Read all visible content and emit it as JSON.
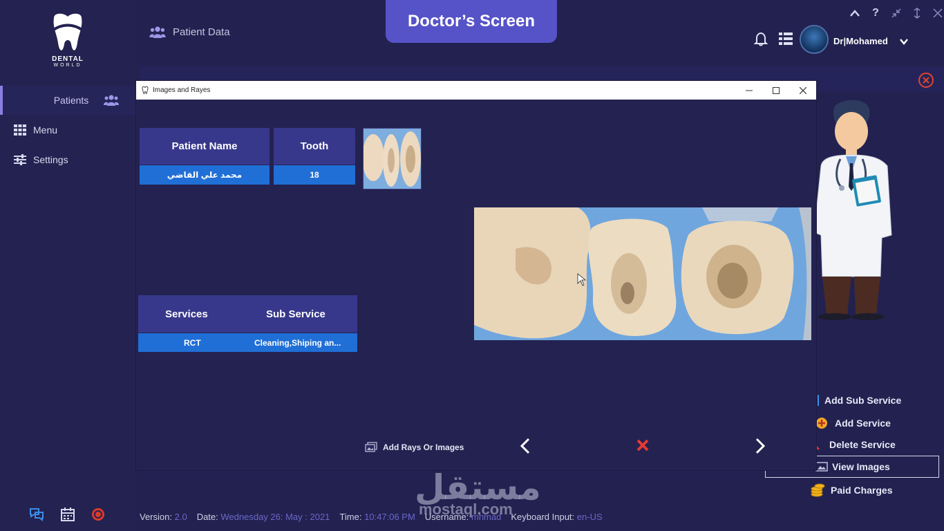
{
  "logo": {
    "line1": "DENTAL",
    "line2": "WORLD"
  },
  "sidebar": {
    "items": [
      {
        "label": "Patients"
      },
      {
        "label": "Menu"
      },
      {
        "label": "Settings"
      }
    ]
  },
  "header": {
    "title": "Patient Data",
    "tab": "Doctor’s Screen",
    "user": "Dr|Mohamed"
  },
  "dialog": {
    "title": "Images and Rayes",
    "patient_table": {
      "headers": [
        "Patient Name",
        "Tooth"
      ],
      "row": [
        "محمد علي القاضي",
        "18"
      ]
    },
    "services_table": {
      "headers": [
        "Services",
        "Sub Service"
      ],
      "row": [
        "RCT",
        "Cleaning,Shiping an..."
      ]
    },
    "add_rays_label": "Add Rays Or Images"
  },
  "actions": [
    {
      "label": "Add Sub Service"
    },
    {
      "label": "Add Service"
    },
    {
      "label": "Delete Service"
    },
    {
      "label": "View Images"
    },
    {
      "label": "Paid Charges"
    }
  ],
  "footer": {
    "version_label": "Version:",
    "version": "2.0",
    "date_label": "Date:",
    "date": "Wednesday 26: May : 2021",
    "time_label": "Time:",
    "time": "10:47:06 PM",
    "username_label": "Username:",
    "username": "mhmad",
    "keyboard_label": "Keyboard Input:",
    "keyboard": "en-US"
  },
  "watermark": {
    "arabic": "مستقل",
    "latin": "mostaql.com"
  },
  "colors": {
    "accent": "#5653c9",
    "cell_blue": "#1f6fd6",
    "header_blue": "#37378c",
    "delete_red": "#e53935"
  }
}
